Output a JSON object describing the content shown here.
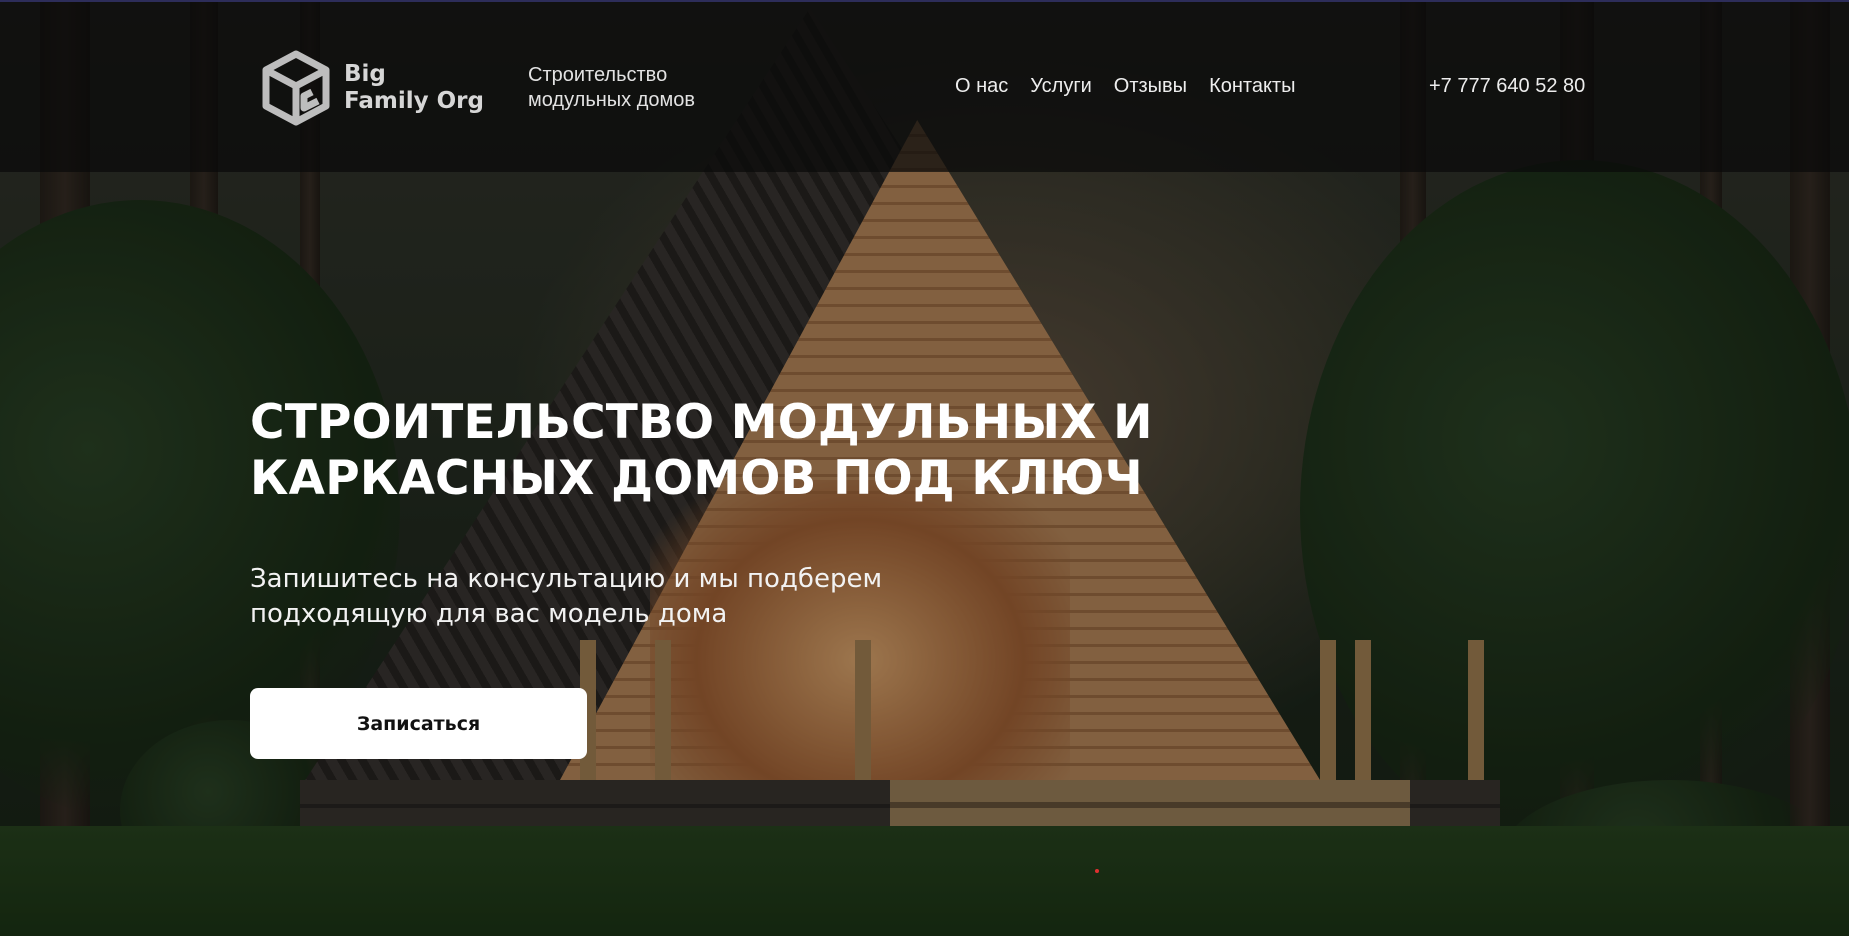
{
  "header": {
    "logo": {
      "line1": "Big",
      "line2": "Family Org"
    },
    "tagline": {
      "line1": "Строительство",
      "line2": "модульных домов"
    },
    "nav": [
      {
        "label": "О нас"
      },
      {
        "label": "Услуги"
      },
      {
        "label": "Отзывы"
      },
      {
        "label": "Контакты"
      }
    ],
    "phone": "+7 777 640 52 80"
  },
  "hero": {
    "title_line1": "СТРОИТЕЛЬСТВО МОДУЛЬНЫХ И",
    "title_line2": "КАРКАСНЫХ ДОМОВ ПОД КЛЮЧ",
    "subtitle_line1": "Запишитесь на консультацию и мы подберем",
    "subtitle_line2": "подходящую для вас модель дома",
    "cta_label": "Записаться"
  },
  "colors": {
    "header_bg": "#0a0a0a",
    "cta_bg": "#ffffff",
    "text": "#ffffff"
  }
}
